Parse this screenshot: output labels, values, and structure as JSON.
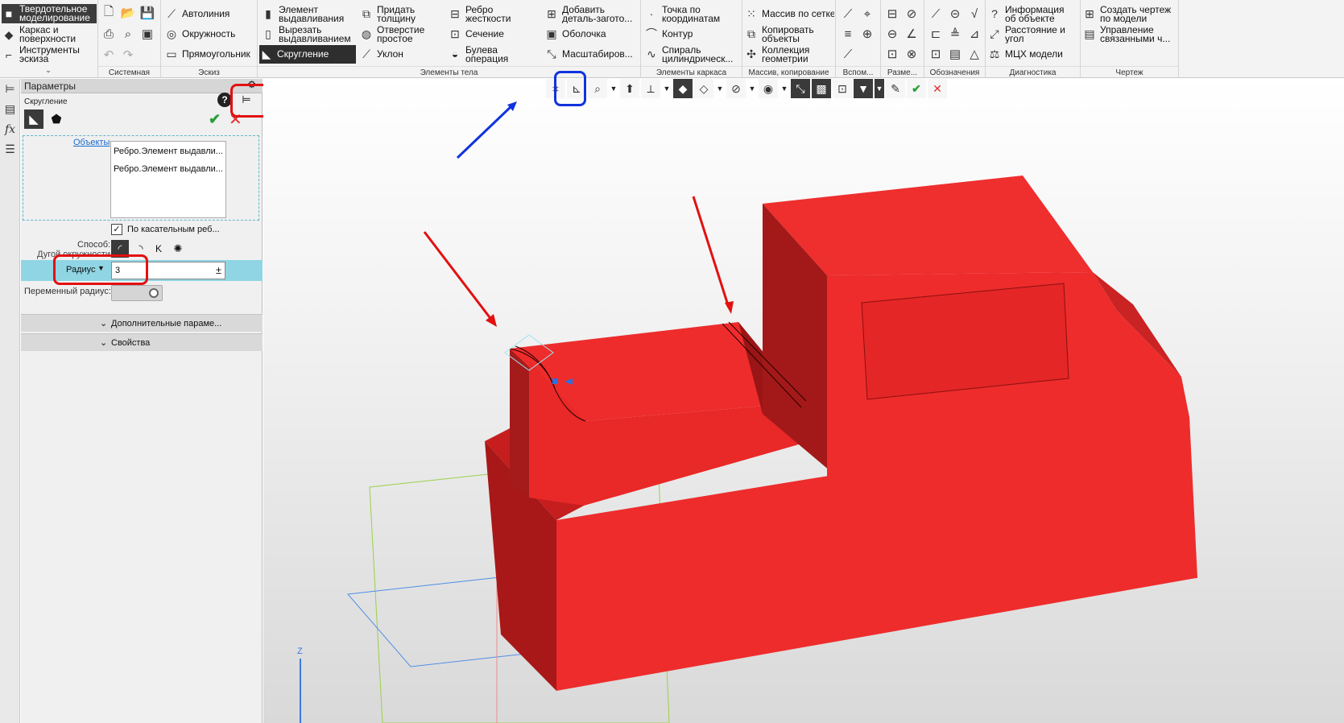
{
  "ribbon": {
    "modes": [
      {
        "label": "Твердотельное моделирование",
        "icon": "solid-modeling-icon",
        "selected": true
      },
      {
        "label": "Каркас и поверхности",
        "icon": "wireframe-icon"
      },
      {
        "label": "Инструменты эскиза",
        "icon": "sketch-tools-icon"
      }
    ],
    "groups": {
      "system": "Системная",
      "sketch": "Эскиз",
      "body": "Элементы тела",
      "frame": "Элементы каркаса",
      "array": "Массив, копирование",
      "aux": "Вспом...",
      "dims": "Разме...",
      "notation": "Обозначения",
      "diag": "Диагностика",
      "drawing": "Чертеж"
    },
    "sketch_buttons": [
      "Автолиния",
      "Окружность",
      "Прямоугольник"
    ],
    "body_buttons": [
      "Элемент выдавливания",
      "Вырезать выдавливанием",
      "Скругление",
      "Придать толщину",
      "Отверстие простое",
      "Уклон",
      "Ребро жесткости",
      "Сечение",
      "Булева операция",
      "Добавить деталь-загото...",
      "Оболочка",
      "Масштабиров..."
    ],
    "frame_buttons": [
      "Точка по координатам",
      "Контур",
      "Спираль цилиндрическ..."
    ],
    "array_buttons": [
      "Массив по сетке",
      "Копировать объекты",
      "Коллекция геометрии"
    ],
    "diag_buttons": [
      "Информация об объекте",
      "Расстояние и угол",
      "МЦХ модели"
    ],
    "drawing_buttons": [
      "Создать чертеж по модели",
      "Управление связанными ч..."
    ]
  },
  "panel": {
    "header": "Параметры",
    "operation": "Скругление",
    "objects_link": "Объекты",
    "objects": [
      "Ребро.Элемент выдавли...",
      "Ребро.Элемент выдавли..."
    ],
    "tangent_label": "По касательным реб...",
    "tangent_checked": true,
    "method_label": "Способ:",
    "arc_label": "Дугой окружности",
    "radius_label": "Радиус",
    "radius_value": "3",
    "radius_pm": "±",
    "var_radius_label": "Переменный радиус:",
    "more_params": "Дополнительные параме...",
    "properties": "Свойства"
  },
  "viewport": {
    "axis_label": "Z",
    "model_color": "#ee2c2c"
  },
  "annotations": {
    "red": "#e31010",
    "blue": "#1133dd"
  }
}
